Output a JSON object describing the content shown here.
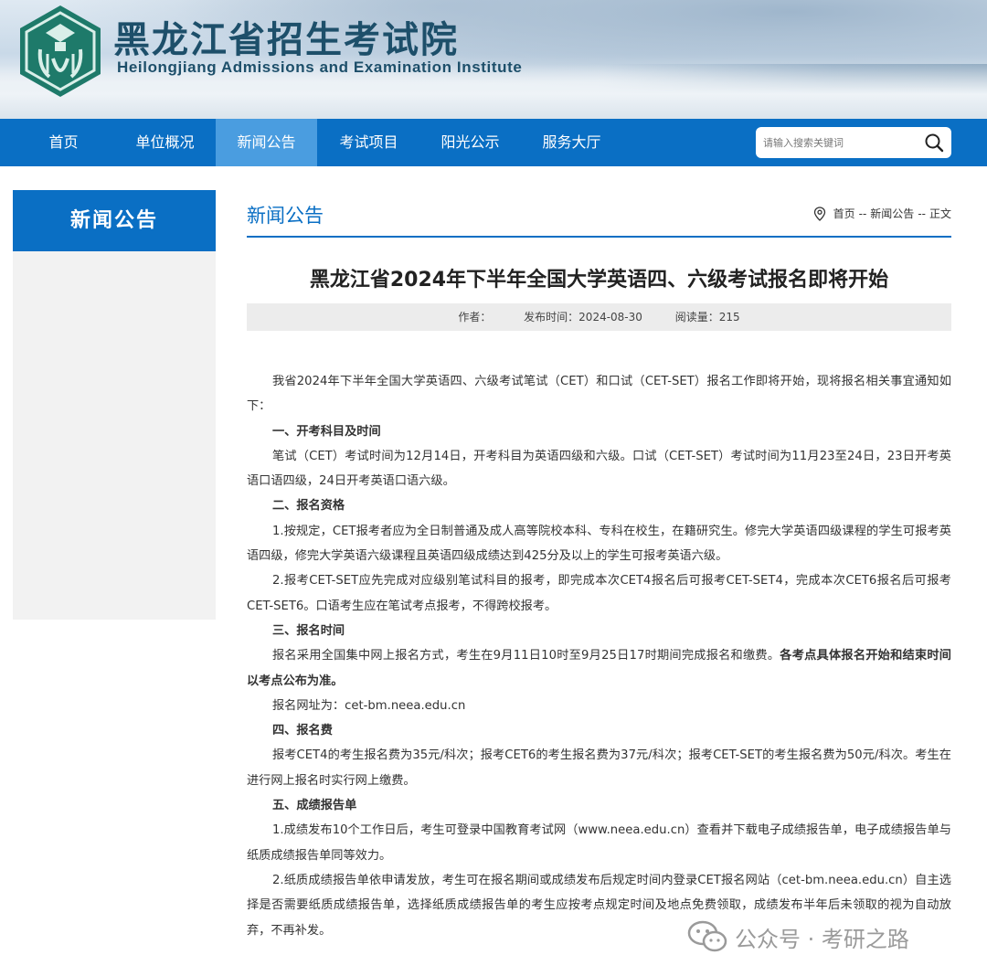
{
  "header": {
    "title": "黑龙江省招生考试院",
    "subtitle": "Heilongjiang Admissions and Examination Institute",
    "logo_icon": "seal-logo-icon"
  },
  "nav": {
    "items": [
      {
        "label": "首页",
        "active": false
      },
      {
        "label": "单位概况",
        "active": false
      },
      {
        "label": "新闻公告",
        "active": true
      },
      {
        "label": "考试项目",
        "active": false
      },
      {
        "label": "阳光公示",
        "active": false
      },
      {
        "label": "服务大厅",
        "active": false
      }
    ],
    "search_placeholder": "请输入搜索关键词",
    "search_icon": "search-icon"
  },
  "sidebar": {
    "heading": "新闻公告"
  },
  "main": {
    "section_title": "新闻公告",
    "breadcrumb": {
      "home": "首页",
      "sep1": "--",
      "section": "新闻公告",
      "sep2": "--",
      "current": "正文"
    },
    "article": {
      "title": "黑龙江省2024年下半年全国大学英语四、六级考试报名即将开始",
      "author_label": "作者：",
      "date_label": "发布时间：2024-08-30",
      "views_label": "阅读量：215",
      "paragraphs": [
        "我省2024年下半年全国大学英语四、六级考试笔试（CET）和口试（CET-SET）报名工作即将开始，现将报名相关事宜通知如下：",
        "一、开考科目及时间",
        "笔试（CET）考试时间为12月14日，开考科目为英语四级和六级。口试（CET-SET）考试时间为11月23至24日，23日开考英语口语四级，24日开考英语口语六级。",
        "二、报名资格",
        "1.按规定，CET报考者应为全日制普通及成人高等院校本科、专科在校生，在籍研究生。修完大学英语四级课程的学生可报考英语四级，修完大学英语六级课程且英语四级成绩达到425分及以上的学生可报考英语六级。",
        "2.报考CET-SET应先完成对应级别笔试科目的报考，即完成本次CET4报名后可报考CET-SET4，完成本次CET6报名后可报考CET-SET6。口语考生应在笔试考点报考，不得跨校报考。",
        "三、报名时间",
        "报名采用全国集中网上报名方式，考生在9月11日10时至9月25日17时期间完成报名和缴费。",
        "各考点具体报名开始和结束时间以考点公布为准。",
        "报名网址为：cet-bm.neea.edu.cn",
        "四、报名费",
        "报考CET4的考生报名费为35元/科次；报考CET6的考生报名费为37元/科次；报考CET-SET的考生报名费为50元/科次。考生在进行网上报名时实行网上缴费。",
        "五、成绩报告单",
        "1.成绩发布10个工作日后，考生可登录中国教育考试网（www.neea.edu.cn）查看并下载电子成绩报告单，电子成绩报告单与纸质成绩报告单同等效力。",
        "2.纸质成绩报告单依申请发放，考生可在报名期间或成绩发布后规定时间内登录CET报名网站（cet-bm.neea.edu.cn）自主选择是否需要纸质成绩报告单，选择纸质成绩报告单的考生应按考点规定时间及地点免费领取，成绩发布半年后未领取的视为自动放弃，不再补发。"
      ]
    }
  },
  "watermark": {
    "text": "公众号 · 考研之路",
    "icon": "wechat-icon"
  },
  "colors": {
    "brand_blue": "#0a6fc4",
    "nav_active": "#4a9de0",
    "title_dark": "#1d4f6a"
  }
}
